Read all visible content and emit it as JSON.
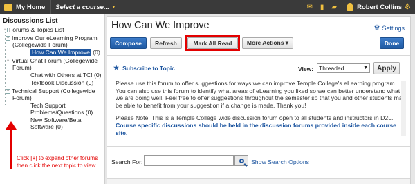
{
  "topbar": {
    "my_home": "My Home",
    "course_select": "Select a course...",
    "user_name": "Robert Collins",
    "icons": [
      "mail-icon",
      "book-icon",
      "chat-icon",
      "user-icon",
      "gear-icon"
    ]
  },
  "sidebar": {
    "title": "Discussions List",
    "root": "Forums & Topics List",
    "forums": [
      {
        "label": "Improve Our eLearning Program (Collegewide Forum)",
        "expander": "−",
        "topics": [
          {
            "label": "How Can We Improve",
            "count": "(0)",
            "selected": true
          }
        ]
      },
      {
        "label": "Virtual Chat Forum (Collegewide Forum)",
        "expander": "−",
        "topics": [
          {
            "label": "Chat with Others at TC!",
            "count": "(0)"
          },
          {
            "label": "Textbook Discussion",
            "count": "(0)"
          }
        ]
      },
      {
        "label": "Technical Support (Collegewide Forum)",
        "expander": "−",
        "topics": [
          {
            "label": "Tech Support Problems/Questions",
            "count": "(0)"
          },
          {
            "label": "New Software/Beta Software",
            "count": "(0)"
          }
        ]
      }
    ],
    "annotation": "Click [+] to expand other forums then click the next topic to view"
  },
  "main": {
    "title": "How Can We Improve",
    "settings_label": "Settings",
    "buttons": {
      "compose": "Compose",
      "refresh": "Refresh",
      "mark_all_read": "Mark All Read",
      "more_actions": "More Actions ▾",
      "done": "Done"
    },
    "subscribe_label": "Subscribe to Topic",
    "view_label": "View:",
    "view_value": "Threaded",
    "apply_label": "Apply",
    "description_1": "Please use this forum to offer suggestions for ways we can improve Temple College's eLearning program. You can also use this forum to identify what areas of eLearning you liked so we can better understand what we are doing well. Feel free to offer suggestions throughout the semester so that you and other students may be able to benefit from your suggestion if a change is made. Thank you!",
    "description_2_plain": "Please Note: This is a Temple College wide discussion forum open to all students and instructors in D2L.",
    "description_2_emph": "Course specific discussions should be held in the discussion forums provided inside each course site.",
    "search_label": "Search For:",
    "search_value": "",
    "show_search_options": "Show Search Options"
  },
  "colors": {
    "accent": "#1e56a0",
    "highlight": "#e30000",
    "topbar": "#3a3a3a"
  }
}
